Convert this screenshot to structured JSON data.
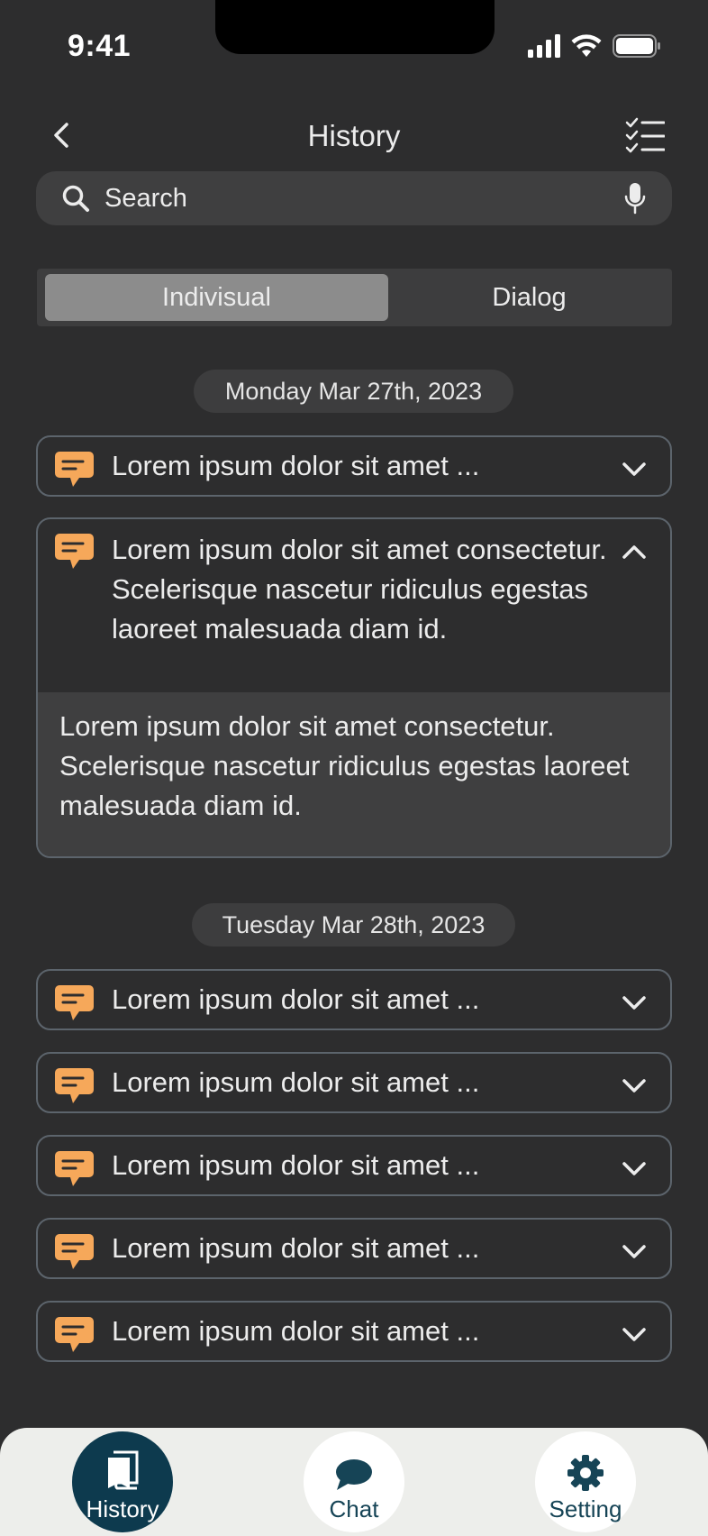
{
  "status": {
    "time": "9:41"
  },
  "nav": {
    "title": "History"
  },
  "search": {
    "placeholder": "Search"
  },
  "segments": {
    "active": "Indivisual",
    "inactive": "Dialog"
  },
  "groups": [
    {
      "date": "Monday Mar 27th, 2023",
      "items": [
        {
          "title": "Lorem ipsum dolor sit amet  ..."
        },
        {
          "title": "Lorem ipsum dolor sit amet consectetur. Scelerisque nascetur ridiculus egestas laoreet malesuada diam id.",
          "body": "Lorem ipsum dolor sit amet consectetur. Scelerisque nascetur ridiculus egestas laoreet malesuada diam id."
        }
      ]
    },
    {
      "date": "Tuesday Mar 28th, 2023",
      "items": [
        {
          "title": "Lorem ipsum dolor sit amet  ..."
        },
        {
          "title": "Lorem ipsum dolor sit amet  ..."
        },
        {
          "title": "Lorem ipsum dolor sit amet  ..."
        },
        {
          "title": "Lorem ipsum dolor sit amet  ..."
        },
        {
          "title": "Lorem ipsum dolor sit amet  ..."
        }
      ]
    }
  ],
  "tabs": [
    {
      "label": "History",
      "icon": "book-icon"
    },
    {
      "label": "Chat",
      "icon": "chat-bubble-icon"
    },
    {
      "label": "Setting",
      "icon": "gear-icon"
    }
  ],
  "colors": {
    "background": "#2d2d2e",
    "accent_icon": "#f6a85a",
    "active_tab": "#0d3a4e",
    "tab_bar": "#edeeeb"
  }
}
